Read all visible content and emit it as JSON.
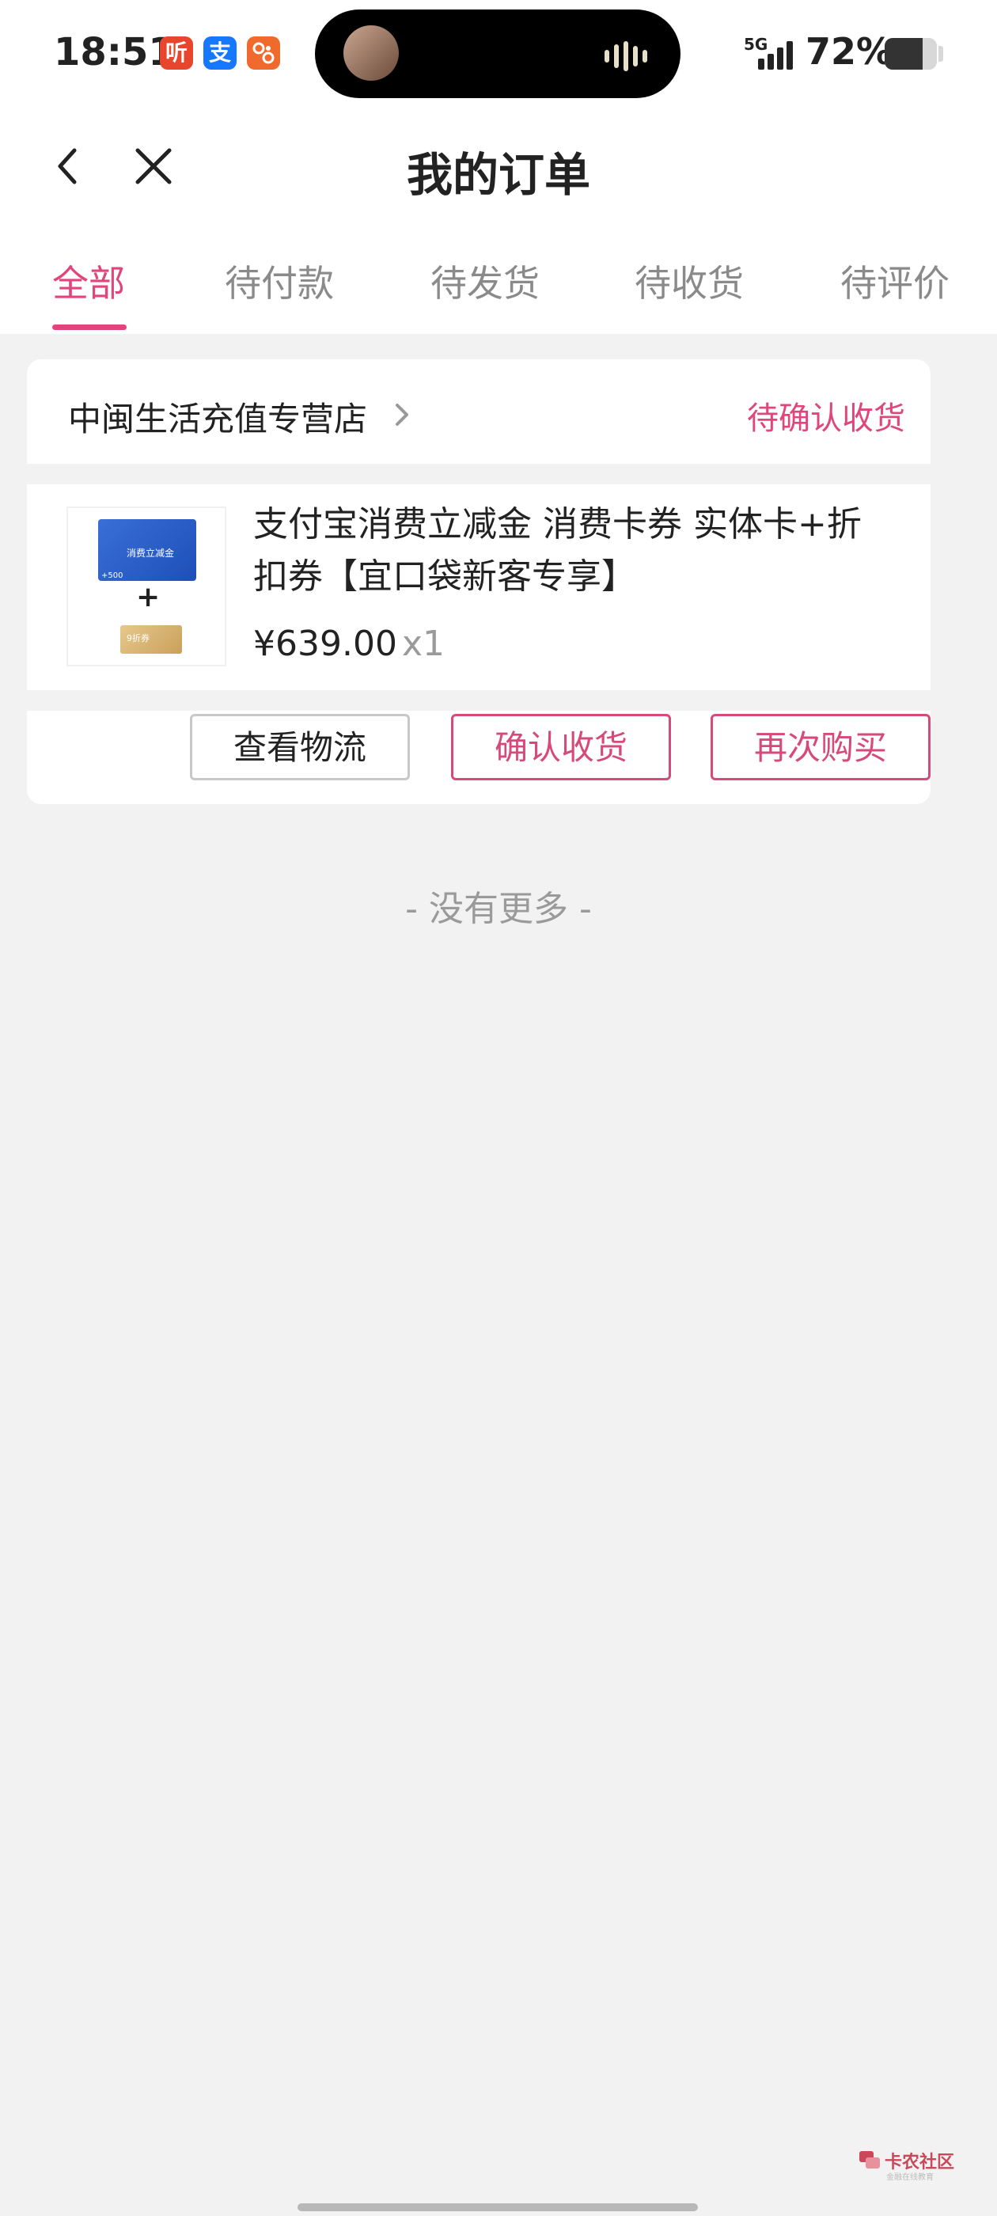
{
  "status_bar": {
    "time": "18:51",
    "app_icons": [
      {
        "name": "ting-app-icon",
        "glyph": "听",
        "color": "#e8462c"
      },
      {
        "name": "alipay-app-icon",
        "glyph": "支",
        "color": "#1677ff"
      },
      {
        "name": "taobao-app-icon",
        "glyph": "",
        "color": "#f06a2e"
      }
    ],
    "network": "5G",
    "battery_percent": "72%",
    "battery_level": 0.72
  },
  "nav": {
    "title": "我的订单",
    "back_icon": "chevron-left-icon",
    "close_icon": "close-icon"
  },
  "tabs": [
    {
      "label": "全部",
      "active": true
    },
    {
      "label": "待付款",
      "active": false
    },
    {
      "label": "待发货",
      "active": false
    },
    {
      "label": "待收货",
      "active": false
    },
    {
      "label": "待评价",
      "active": false
    }
  ],
  "order": {
    "shop_name": "中闽生活充值专营店",
    "status": "待确认收货",
    "product_title": "支付宝消费立减金 消费卡券 实体卡+折扣券【宜口袋新客专享】",
    "price": "¥639.00",
    "quantity": "x1",
    "thumbnail": {
      "card_text": "消费立减金",
      "card_value": "+500",
      "coupon_text": "9折券",
      "plus": "+"
    },
    "buttons": {
      "logistics": "查看物流",
      "confirm": "确认收货",
      "rebuy": "再次购买"
    }
  },
  "footer": {
    "no_more": "- 没有更多 -"
  },
  "watermark": {
    "text": "卡农社区",
    "sub": "金融在线教育"
  },
  "colors": {
    "accent": "#e0457b",
    "button_accent": "#d64a7a",
    "background": "#f2f2f2"
  }
}
